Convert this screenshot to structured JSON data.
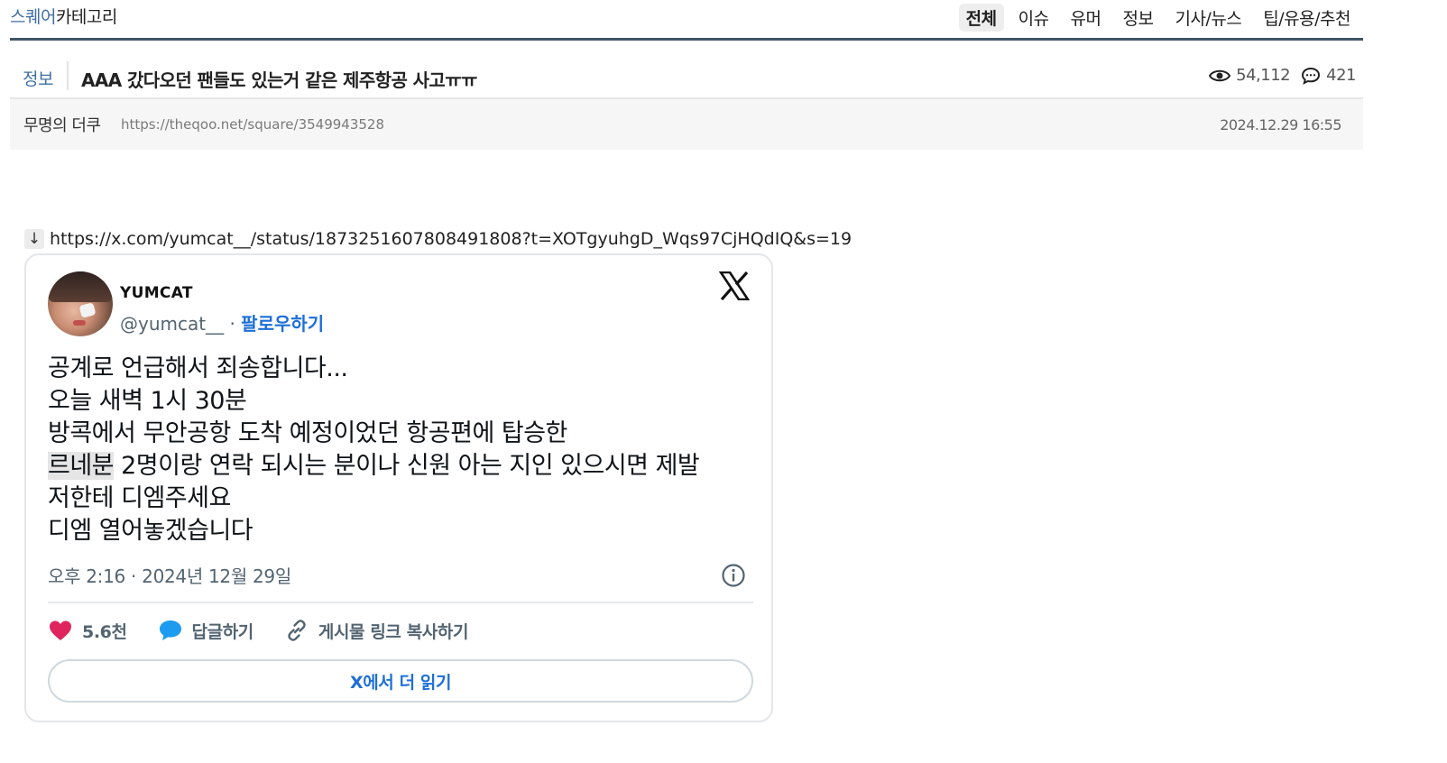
{
  "header": {
    "brand": "스퀘어",
    "category": "카테고리",
    "tabs": [
      {
        "label": "전체",
        "active": true
      },
      {
        "label": "이슈"
      },
      {
        "label": "유머"
      },
      {
        "label": "정보"
      },
      {
        "label": "기사/뉴스"
      },
      {
        "label": "팁/유용/추천"
      }
    ]
  },
  "post": {
    "category": "정보",
    "title": "AAA 갔다오던 팬들도 있는거 같은 제주항공 사고ㅠㅠ",
    "views": "54,112",
    "comments": "421",
    "author": "무명의 더쿠",
    "url": "https://theqoo.net/square/3549943528",
    "date": "2024.12.29 16:55"
  },
  "embed": {
    "arrow": "↓",
    "link": "https://x.com/yumcat__/status/1873251607808491808?t=XOTgyuhgD_Wqs97CjHQdIQ&s=19"
  },
  "tweet": {
    "name": "YUMCAT",
    "handle": "@yumcat__",
    "separator": " · ",
    "follow": "팔로우하기",
    "lines": [
      "공계로 언급해서 죄송합니다...",
      "오늘 새벽 1시 30분",
      "방콕에서 무안공항 도착 예정이었던 항공편에 탑승한"
    ],
    "line4_highlight": "르네분",
    "line4_rest": " 2명이랑 연락 되시는 분이나 신원 아는 지인 있으시면 제발",
    "lines_after": [
      "저한테 디엠주세요",
      "디엠 열어놓겠습니다"
    ],
    "time": "오후 2:16 · 2024년 12월 29일",
    "likes": "5.6천",
    "reply": "답글하기",
    "copy_link": "게시물 링크 복사하기",
    "read_more": "X에서 더 읽기"
  },
  "colors": {
    "brand_blue": "#3f6fa3",
    "follow_blue": "#1d6fd8",
    "like_pink": "#e0245e",
    "reply_blue": "#1d9bf0"
  }
}
